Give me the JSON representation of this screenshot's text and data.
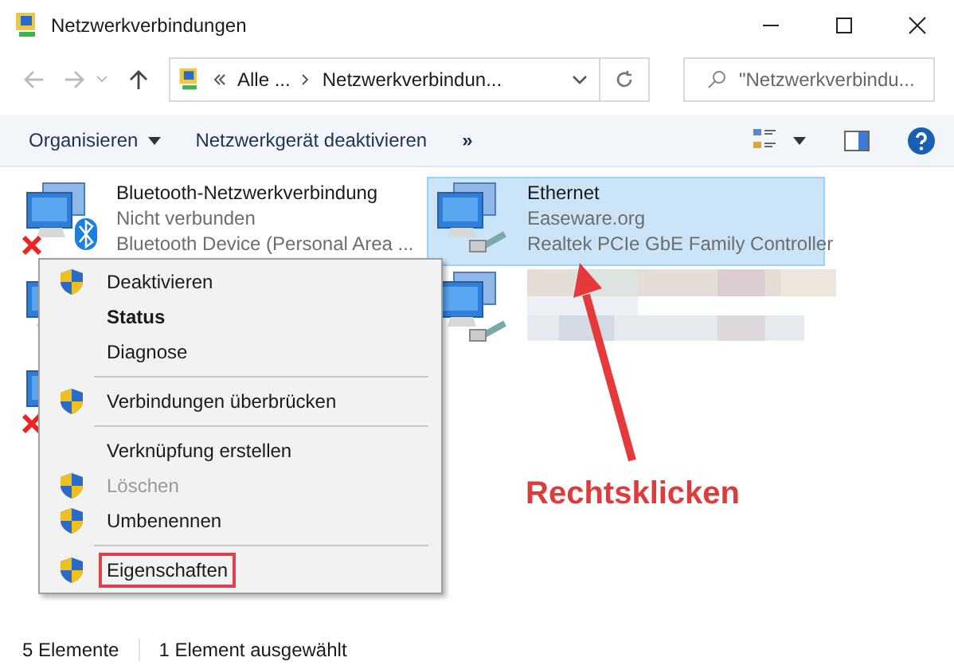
{
  "window": {
    "title": "Netzwerkverbindungen"
  },
  "address": {
    "path": [
      "Alle ...",
      "Netzwerkverbindun..."
    ]
  },
  "search": {
    "placeholder": "\"Netzwerkverbindu..."
  },
  "toolbar": {
    "items": [
      {
        "label": "Organisieren",
        "kind": "dropdown"
      },
      {
        "label": "Netzwerkgerät deaktivieren",
        "kind": "button"
      }
    ],
    "more": "»"
  },
  "connections": [
    {
      "kind": "text",
      "name": "Bluetooth-Netzwerkverbindung",
      "status": "Nicht verbunden",
      "device": "Bluetooth Device (Personal Area ...",
      "selected": false,
      "disconnected": true,
      "bluetooth": true,
      "cable": false
    },
    {
      "kind": "text",
      "name": "Ethernet",
      "status": "Easeware.org",
      "device": "Realtek PCIe GbE Family Controller",
      "selected": true,
      "disconnected": false,
      "bluetooth": false,
      "cable": true
    },
    {
      "kind": "covered",
      "selected": false,
      "disconnected": false
    },
    {
      "kind": "blurred",
      "selected": false,
      "disconnected": false,
      "bluetooth": false,
      "cable": true
    },
    {
      "kind": "covered",
      "selected": false,
      "disconnected": true
    }
  ],
  "context_menu": {
    "items": [
      {
        "kind": "item",
        "label": "Deaktivieren",
        "shield": true,
        "bold": false,
        "disabled": false,
        "highlighted": false
      },
      {
        "kind": "item",
        "label": "Status",
        "shield": false,
        "bold": true,
        "disabled": false,
        "highlighted": false
      },
      {
        "kind": "item",
        "label": "Diagnose",
        "shield": false,
        "bold": false,
        "disabled": false,
        "highlighted": false
      },
      {
        "kind": "separator"
      },
      {
        "kind": "item",
        "label": "Verbindungen überbrücken",
        "shield": true,
        "bold": false,
        "disabled": false,
        "highlighted": false
      },
      {
        "kind": "separator"
      },
      {
        "kind": "item",
        "label": "Verknüpfung erstellen",
        "shield": false,
        "bold": false,
        "disabled": false,
        "highlighted": false
      },
      {
        "kind": "item",
        "label": "Löschen",
        "shield": true,
        "bold": false,
        "disabled": true,
        "highlighted": false
      },
      {
        "kind": "item",
        "label": "Umbenennen",
        "shield": true,
        "bold": false,
        "disabled": false,
        "highlighted": false
      },
      {
        "kind": "separator"
      },
      {
        "kind": "item",
        "label": "Eigenschaften",
        "shield": true,
        "bold": false,
        "disabled": false,
        "highlighted": true
      }
    ]
  },
  "annotation": {
    "text": "Rechtsklicken"
  },
  "status_bar": [
    "5 Elemente",
    "1 Element ausgewählt"
  ]
}
